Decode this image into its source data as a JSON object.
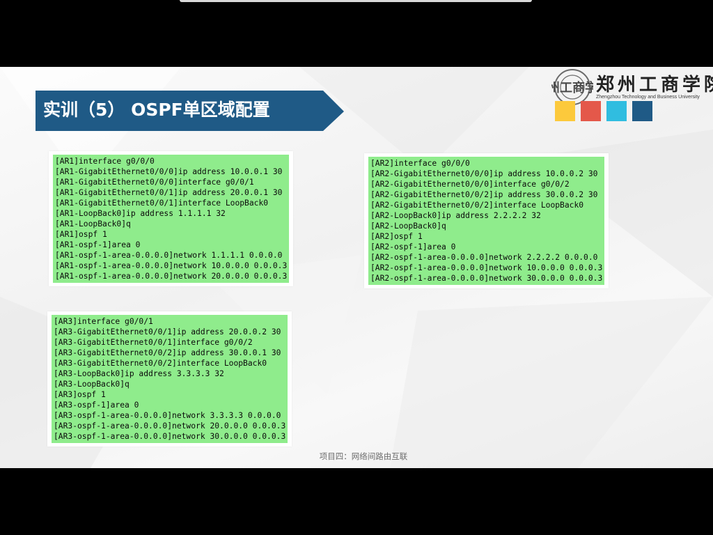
{
  "slide": {
    "title": "实训（5） OSPF单区域配置",
    "footer": "项目四：网络间路由互联",
    "logo": {
      "name": "郑州工商学院",
      "subtitle": "Zhengzhou Technology and Business University",
      "seal_text": "郑州工商学院"
    },
    "accent_colors": [
      "#fcc93c",
      "#e4584a",
      "#30bde0",
      "#1f5a86"
    ],
    "title_banner_color": "#1f5a86",
    "panels": [
      {
        "id": "ar1",
        "lines": [
          "[AR1]interface g0/0/0",
          "[AR1-GigabitEthernet0/0/0]ip address 10.0.0.1 30",
          "[AR1-GigabitEthernet0/0/0]interface g0/0/1",
          "[AR1-GigabitEthernet0/0/1]ip address 20.0.0.1 30",
          "[AR1-GigabitEthernet0/0/1]interface LoopBack0",
          "[AR1-LoopBack0]ip address 1.1.1.1 32",
          "[AR1-LoopBack0]q",
          "[AR1]ospf 1",
          "[AR1-ospf-1]area 0",
          "[AR1-ospf-1-area-0.0.0.0]network 1.1.1.1 0.0.0.0",
          "[AR1-ospf-1-area-0.0.0.0]network 10.0.0.0 0.0.0.3",
          "[AR1-ospf-1-area-0.0.0.0]network 20.0.0.0 0.0.0.3"
        ]
      },
      {
        "id": "ar2",
        "lines": [
          "[AR2]interface g0/0/0",
          "[AR2-GigabitEthernet0/0/0]ip address 10.0.0.2 30",
          "[AR2-GigabitEthernet0/0/0]interface g0/0/2",
          "[AR2-GigabitEthernet0/0/2]ip address 30.0.0.2 30",
          "[AR2-GigabitEthernet0/0/2]interface LoopBack0",
          "[AR2-LoopBack0]ip address 2.2.2.2 32",
          "[AR2-LoopBack0]q",
          "[AR2]ospf 1",
          "[AR2-ospf-1]area 0",
          "[AR2-ospf-1-area-0.0.0.0]network 2.2.2.2 0.0.0.0",
          "[AR2-ospf-1-area-0.0.0.0]network 10.0.0.0 0.0.0.3",
          "[AR2-ospf-1-area-0.0.0.0]network 30.0.0.0 0.0.0.3"
        ]
      },
      {
        "id": "ar3",
        "lines": [
          "[AR3]interface g0/0/1",
          "[AR3-GigabitEthernet0/0/1]ip address 20.0.0.2 30",
          "[AR3-GigabitEthernet0/0/1]interface g0/0/2",
          "[AR3-GigabitEthernet0/0/2]ip address 30.0.0.1 30",
          "[AR3-GigabitEthernet0/0/2]interface LoopBack0",
          "[AR3-LoopBack0]ip address 3.3.3.3 32",
          "[AR3-LoopBack0]q",
          "[AR3]ospf 1",
          "[AR3-ospf-1]area 0",
          "[AR3-ospf-1-area-0.0.0.0]network 3.3.3.3 0.0.0.0",
          "[AR3-ospf-1-area-0.0.0.0]network 20.0.0.0 0.0.0.3",
          "[AR3-ospf-1-area-0.0.0.0]network 30.0.0.0 0.0.0.3"
        ]
      }
    ]
  }
}
